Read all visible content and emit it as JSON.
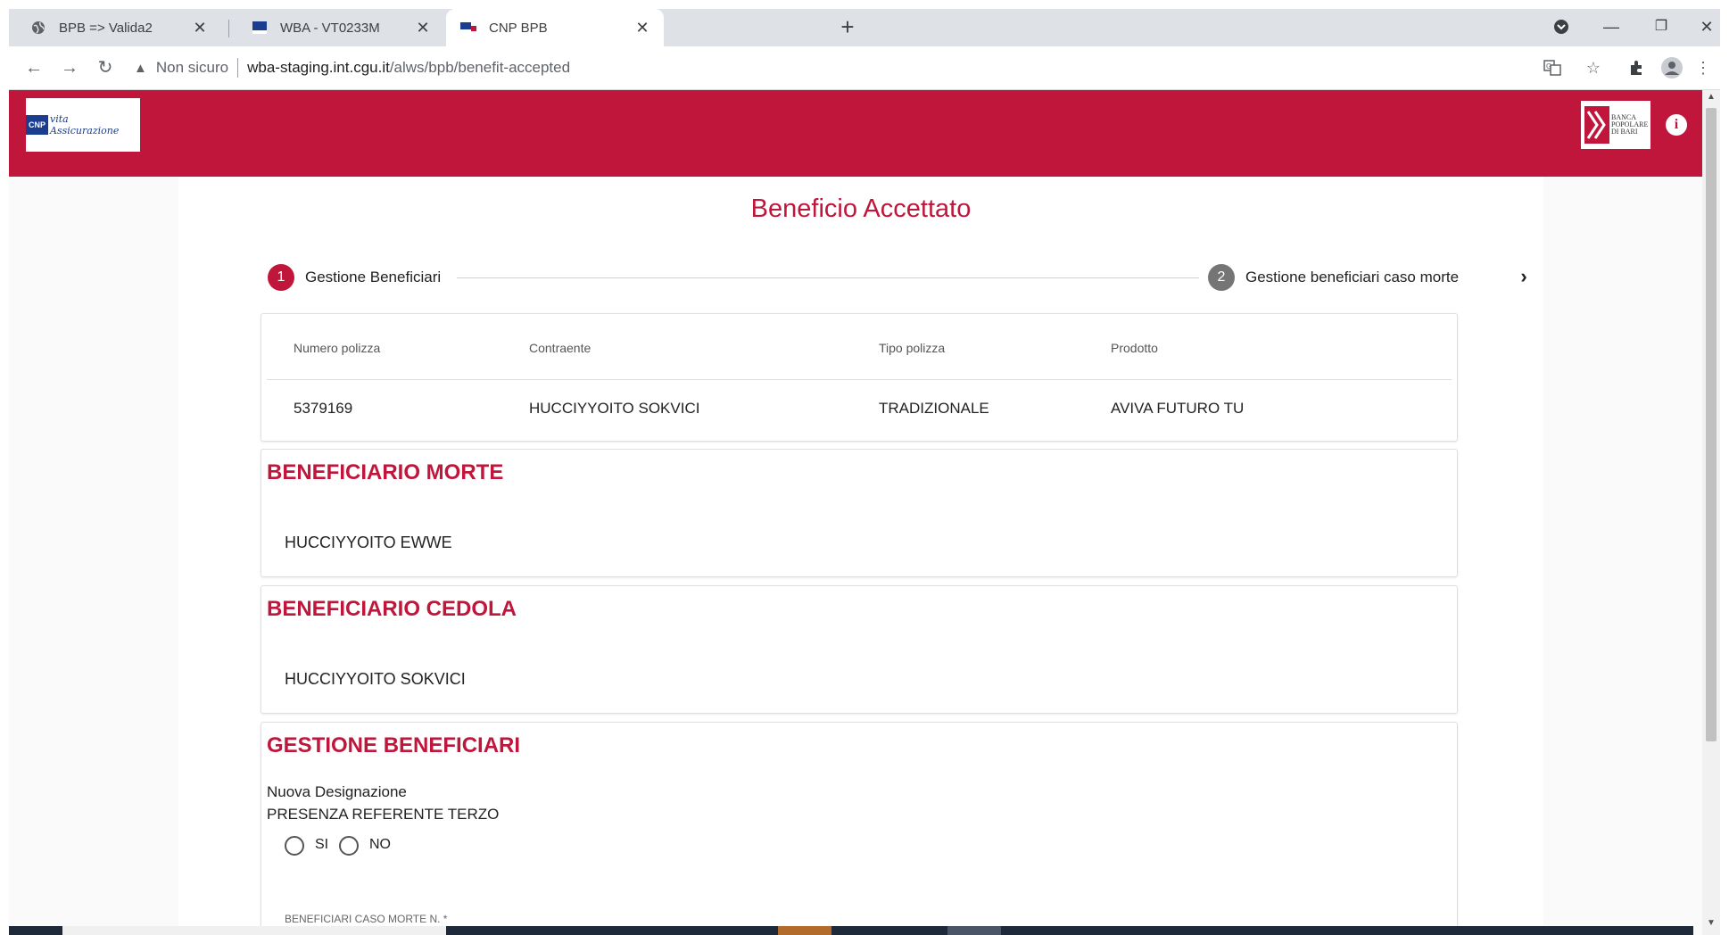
{
  "browser": {
    "tabs": [
      {
        "title": "BPB => Valida2",
        "icon": "globe-icon",
        "active": false
      },
      {
        "title": "WBA - VT0233M",
        "icon": "cnp-favicon",
        "active": false
      },
      {
        "title": "CNP BPB",
        "icon": "cnp-favicon",
        "active": true
      }
    ],
    "address": {
      "security_label": "Non sicuro",
      "host": "wba-staging.int.cgu.it",
      "path": "/alws/bpb/benefit-accepted"
    }
  },
  "header": {
    "brand_left": {
      "mark": "CNP",
      "text": "vita Assicurazione"
    },
    "brand_right": {
      "lines": [
        "BANCA",
        "POPOLARE",
        "DI BARI"
      ]
    },
    "info_symbol": "i",
    "color": "#c0163b"
  },
  "page": {
    "title": "Beneficio Accettato"
  },
  "stepper": {
    "steps": [
      {
        "number": "1",
        "label": "Gestione Beneficiari",
        "active": true
      },
      {
        "number": "2",
        "label": "Gestione beneficiari caso morte",
        "active": false
      }
    ]
  },
  "policy_table": {
    "headers": [
      "Numero polizza",
      "Contraente",
      "Tipo polizza",
      "Prodotto"
    ],
    "row": [
      "5379169",
      "HUCCIYYOITO SOKVICI",
      "TRADIZIONALE",
      "AVIVA FUTURO TU"
    ]
  },
  "beneficiario_morte": {
    "title": "BENEFICIARIO MORTE",
    "name": "HUCCIYYOITO EWWE"
  },
  "beneficiario_cedola": {
    "title": "BENEFICIARIO CEDOLA",
    "name": "HUCCIYYOITO SOKVICI"
  },
  "gestione_beneficiari": {
    "title": "GESTIONE BENEFICIARI",
    "designation": "Nuova Designazione",
    "question": "PRESENZA REFERENTE TERZO",
    "options": [
      "SI",
      "NO"
    ],
    "selected": null,
    "field_label": "BENEFICIARI CASO MORTE N. *"
  }
}
